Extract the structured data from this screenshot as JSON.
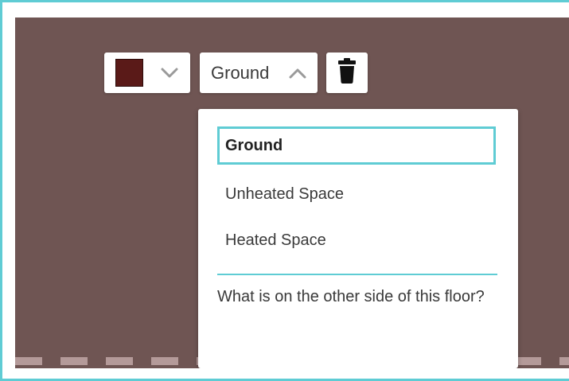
{
  "toolbar": {
    "color_swatch": "#5a1a18",
    "color_dropdown_icon": "chevron-down-icon",
    "selected_option": "Ground",
    "selected_dropdown_icon": "chevron-up-icon",
    "delete_icon": "trash-icon"
  },
  "dropdown": {
    "options": [
      {
        "label": "Ground",
        "selected": true
      },
      {
        "label": "Unheated Space",
        "selected": false
      },
      {
        "label": "Heated Space",
        "selected": false
      }
    ],
    "hint": "What is on the other side of this floor?"
  },
  "colors": {
    "canvas": "#6f5553",
    "accent": "#5fccd4"
  }
}
